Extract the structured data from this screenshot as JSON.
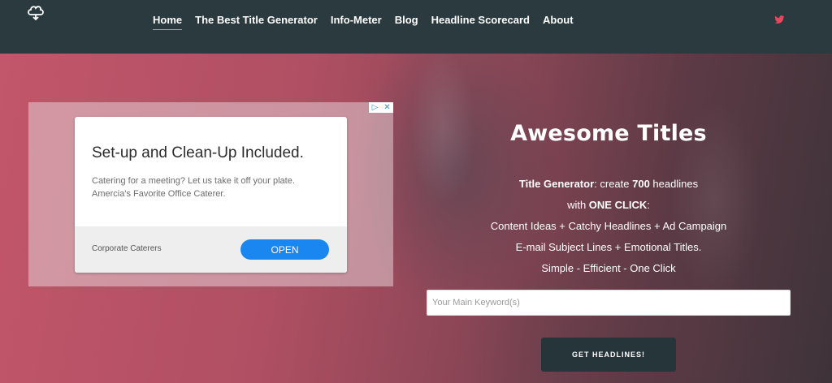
{
  "header": {
    "logo_icon": "brain-cloud-icon",
    "nav": [
      {
        "label": "Home",
        "active": true
      },
      {
        "label": "The Best Title Generator",
        "active": false
      },
      {
        "label": "Info-Meter",
        "active": false
      },
      {
        "label": "Blog",
        "active": false
      },
      {
        "label": "Headline Scorecard",
        "active": false
      },
      {
        "label": "About",
        "active": false
      }
    ],
    "social_icon": "twitter-icon",
    "social_color": "#e8475f"
  },
  "ad": {
    "headline": "Set-up and Clean-Up Included.",
    "description_line1": "Catering for a meeting? Let us take it off your plate.",
    "description_line2": "Amercia's Favorite Office Caterer.",
    "advertiser": "Corporate Caterers",
    "cta_label": "OPEN",
    "adchoices_icon": "adchoices-icon",
    "close_icon": "close-icon",
    "cta_color": "#1a86f0"
  },
  "hero": {
    "title": "Awesome Titles",
    "line1_bold": "Title Generator",
    "line1_rest": ": create ",
    "line1_count": "700",
    "line1_end": " headlines",
    "line2_start": "with ",
    "line2_bold": "ONE CLICK",
    "line2_end": ":",
    "line3": "Content Ideas + Catchy Headlines + Ad Campaign",
    "line4": "E-mail Subject Lines + Emotional Titles.",
    "line5": "Simple - Efficient - One Click",
    "keyword_placeholder": "Your Main Keyword(s)",
    "keyword_value": "",
    "cta_label": "GET HEADLINES!"
  },
  "colors": {
    "header_bg": "#2b3a3e",
    "hero_gradient_start": "#c2566a",
    "hero_gradient_end": "#3e3339",
    "button_bg": "#26353a"
  }
}
